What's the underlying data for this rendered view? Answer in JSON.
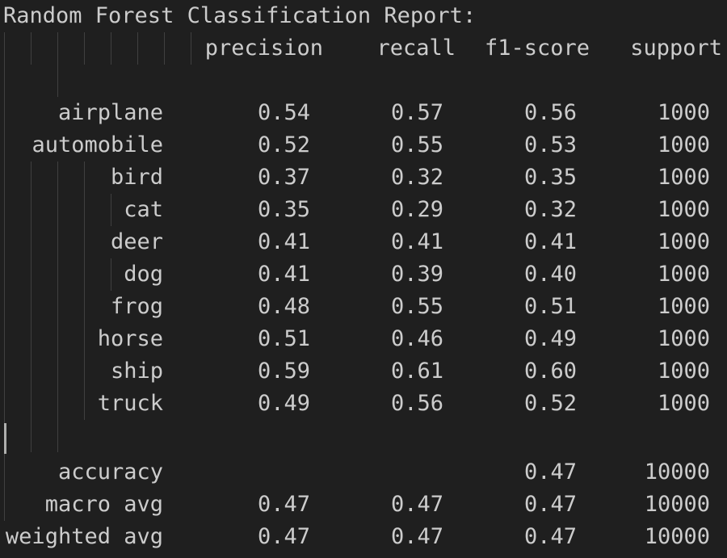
{
  "terminal": {
    "title_line": "Random Forest Classification Report:",
    "headers": {
      "precision": "precision",
      "recall": "recall",
      "f1": "f1-score",
      "support": "support"
    },
    "rows": [
      {
        "label": "airplane",
        "precision": "0.54",
        "recall": "0.57",
        "f1": "0.56",
        "support": "1000"
      },
      {
        "label": "automobile",
        "precision": "0.52",
        "recall": "0.55",
        "f1": "0.53",
        "support": "1000"
      },
      {
        "label": "bird",
        "precision": "0.37",
        "recall": "0.32",
        "f1": "0.35",
        "support": "1000"
      },
      {
        "label": "cat",
        "precision": "0.35",
        "recall": "0.29",
        "f1": "0.32",
        "support": "1000"
      },
      {
        "label": "deer",
        "precision": "0.41",
        "recall": "0.41",
        "f1": "0.41",
        "support": "1000"
      },
      {
        "label": "dog",
        "precision": "0.41",
        "recall": "0.39",
        "f1": "0.40",
        "support": "1000"
      },
      {
        "label": "frog",
        "precision": "0.48",
        "recall": "0.55",
        "f1": "0.51",
        "support": "1000"
      },
      {
        "label": "horse",
        "precision": "0.51",
        "recall": "0.46",
        "f1": "0.49",
        "support": "1000"
      },
      {
        "label": "ship",
        "precision": "0.59",
        "recall": "0.61",
        "f1": "0.60",
        "support": "1000"
      },
      {
        "label": "truck",
        "precision": "0.49",
        "recall": "0.56",
        "f1": "0.52",
        "support": "1000"
      }
    ],
    "summary": [
      {
        "label": "accuracy",
        "precision": "",
        "recall": "",
        "f1": "0.47",
        "support": "10000"
      },
      {
        "label": "macro avg",
        "precision": "0.47",
        "recall": "0.47",
        "f1": "0.47",
        "support": "10000"
      },
      {
        "label": "weighted avg",
        "precision": "0.47",
        "recall": "0.47",
        "f1": "0.47",
        "support": "10000"
      }
    ]
  },
  "colors": {
    "background": "#1f1f1f",
    "text": "#cccccc",
    "indent_guide": "#404040",
    "cursor": "#aeafad"
  }
}
